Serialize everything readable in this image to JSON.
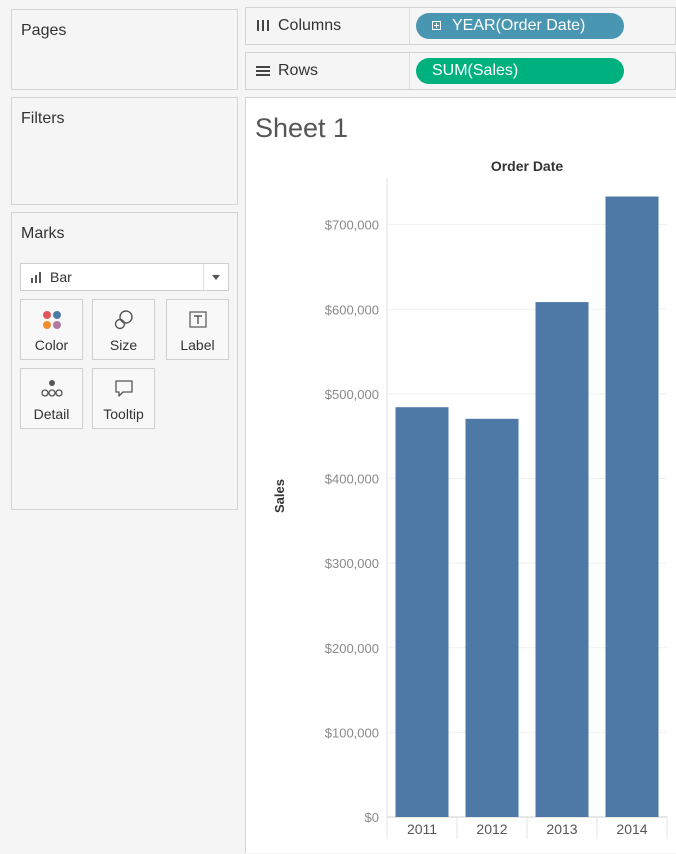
{
  "panels": {
    "pages": {
      "title": "Pages"
    },
    "filters": {
      "title": "Filters"
    },
    "marks": {
      "title": "Marks",
      "mark_type": {
        "label": "Bar",
        "icon": "bar-chart-icon"
      },
      "cards": [
        {
          "label": "Color",
          "icon": "color-dots-icon"
        },
        {
          "label": "Size",
          "icon": "size-icon"
        },
        {
          "label": "Label",
          "icon": "text-label-icon"
        },
        {
          "label": "Detail",
          "icon": "detail-icon"
        },
        {
          "label": "Tooltip",
          "icon": "tooltip-icon"
        }
      ]
    }
  },
  "shelves": {
    "columns": {
      "label": "Columns",
      "icon": "columns-icon",
      "pill": "YEAR(Order Date)",
      "pill_color": "#4996b2"
    },
    "rows": {
      "label": "Rows",
      "icon": "rows-icon",
      "pill": "SUM(Sales)",
      "pill_color": "#00b180"
    }
  },
  "sheet": {
    "title": "Sheet 1"
  },
  "colors": {
    "bar": "#4e79a7"
  },
  "chart_data": {
    "type": "bar",
    "title": "Order Date",
    "xlabel": "",
    "ylabel": "Sales",
    "categories": [
      "2011",
      "2012",
      "2013",
      "2014"
    ],
    "values": [
      484247,
      470533,
      608474,
      733215
    ],
    "ylim": [
      0,
      800000
    ],
    "yticks": [
      {
        "value": 0,
        "label": "$0"
      },
      {
        "value": 100000,
        "label": "$100,000"
      },
      {
        "value": 200000,
        "label": "$200,000"
      },
      {
        "value": 300000,
        "label": "$300,000"
      },
      {
        "value": 400000,
        "label": "$400,000"
      },
      {
        "value": 500000,
        "label": "$500,000"
      },
      {
        "value": 600000,
        "label": "$600,000"
      },
      {
        "value": 700000,
        "label": "$700,000"
      }
    ],
    "grid": true,
    "legend": "none"
  }
}
